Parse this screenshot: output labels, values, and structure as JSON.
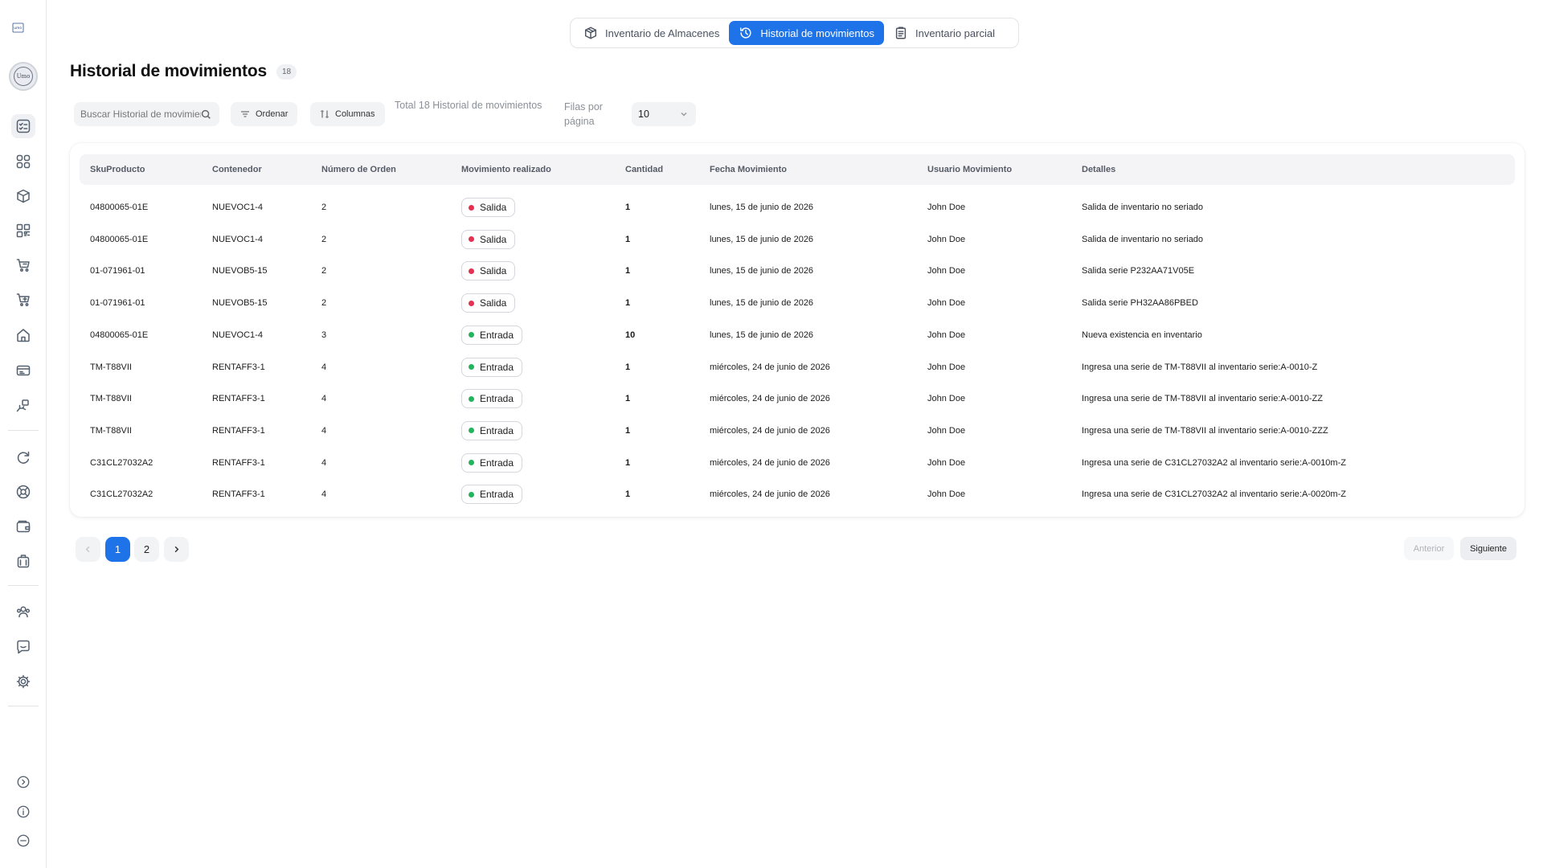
{
  "sidebar": {
    "logo_icon": "company-logo-icon",
    "avatar_text": "Umo",
    "items": [
      {
        "name": "sidebar-item-movements",
        "icon": "checklist-icon",
        "active": true
      },
      {
        "name": "sidebar-item-dashboard",
        "icon": "grid-icon"
      },
      {
        "name": "sidebar-item-products",
        "icon": "box-icon"
      },
      {
        "name": "sidebar-item-qr",
        "icon": "qr-code-icon"
      },
      {
        "name": "sidebar-item-purchases",
        "icon": "cart-icon"
      },
      {
        "name": "sidebar-item-orders",
        "icon": "cart-alt-icon"
      },
      {
        "name": "sidebar-item-warehouse",
        "icon": "home-icon"
      },
      {
        "name": "sidebar-item-tickets",
        "icon": "ticket-icon"
      },
      {
        "name": "sidebar-item-rentals",
        "icon": "hand-icon"
      },
      {
        "name": "sidebar-item-sync",
        "icon": "refresh-icon"
      },
      {
        "name": "sidebar-item-support",
        "icon": "lifebuoy-icon"
      },
      {
        "name": "sidebar-item-wallet",
        "icon": "wallet-icon"
      },
      {
        "name": "sidebar-item-documents",
        "icon": "briefcase-icon"
      },
      {
        "name": "sidebar-item-users",
        "icon": "users-icon"
      },
      {
        "name": "sidebar-item-messages",
        "icon": "chat-icon"
      },
      {
        "name": "sidebar-item-settings",
        "icon": "gear-icon"
      }
    ],
    "footer": [
      {
        "name": "expand-button",
        "icon": "chevron-right-circle-icon"
      },
      {
        "name": "info-button",
        "icon": "info-icon"
      },
      {
        "name": "logout-button",
        "icon": "minus-circle-icon"
      }
    ]
  },
  "tabs": [
    {
      "label": "Inventario de Almacenes",
      "icon": "package-icon",
      "active": false
    },
    {
      "label": "Historial de movimientos",
      "icon": "history-icon",
      "active": true
    },
    {
      "label": "Inventario parcial",
      "icon": "clipboard-icon",
      "active": false
    }
  ],
  "header": {
    "title": "Historial de movimientos",
    "count": "18"
  },
  "toolbar": {
    "search_placeholder": "Buscar Historial de movimientos",
    "sort_label": "Ordenar",
    "columns_label": "Columnas",
    "total_text": "Total 18 Historial de movimientos",
    "rows_label": "Filas por página",
    "rows_value": "10"
  },
  "colors": {
    "accent": "#1f73e8",
    "salida": "#e5304f",
    "entrada": "#22b45a"
  },
  "table": {
    "columns": [
      "SkuProducto",
      "Contenedor",
      "Número de Orden",
      "Movimiento realizado",
      "Cantidad",
      "Fecha Movimiento",
      "Usuario Movimiento",
      "Detalles"
    ],
    "rows": [
      [
        "04800065-01E",
        "NUEVOC1-4",
        "2",
        "Salida",
        "1",
        "lunes, 15 de junio de 2026",
        "John Doe",
        "Salida de inventario no seriado"
      ],
      [
        "04800065-01E",
        "NUEVOC1-4",
        "2",
        "Salida",
        "1",
        "lunes, 15 de junio de 2026",
        "John Doe",
        "Salida de inventario no seriado"
      ],
      [
        "01-071961-01",
        "NUEVOB5-15",
        "2",
        "Salida",
        "1",
        "lunes, 15 de junio de 2026",
        "John Doe",
        "Salida serie P232AA71V05E"
      ],
      [
        "01-071961-01",
        "NUEVOB5-15",
        "2",
        "Salida",
        "1",
        "lunes, 15 de junio de 2026",
        "John Doe",
        "Salida serie PH32AA86PBED"
      ],
      [
        "04800065-01E",
        "NUEVOC1-4",
        "3",
        "Entrada",
        "10",
        "lunes, 15 de junio de 2026",
        "John Doe",
        "Nueva existencia en inventario"
      ],
      [
        "TM-T88VII",
        "RENTAFF3-1",
        "4",
        "Entrada",
        "1",
        "miércoles, 24 de junio de 2026",
        "John Doe",
        "Ingresa una serie de TM-T88VII al inventario serie:A-0010-Z"
      ],
      [
        "TM-T88VII",
        "RENTAFF3-1",
        "4",
        "Entrada",
        "1",
        "miércoles, 24 de junio de 2026",
        "John Doe",
        "Ingresa una serie de TM-T88VII al inventario serie:A-0010-ZZ"
      ],
      [
        "TM-T88VII",
        "RENTAFF3-1",
        "4",
        "Entrada",
        "1",
        "miércoles, 24 de junio de 2026",
        "John Doe",
        "Ingresa una serie de TM-T88VII al inventario serie:A-0010-ZZZ"
      ],
      [
        "C31CL27032A2",
        "RENTAFF3-1",
        "4",
        "Entrada",
        "1",
        "miércoles, 24 de junio de 2026",
        "John Doe",
        "Ingresa una serie de C31CL27032A2 al inventario serie:A-0010m-Z"
      ],
      [
        "C31CL27032A2",
        "RENTAFF3-1",
        "4",
        "Entrada",
        "1",
        "miércoles, 24 de junio de 2026",
        "John Doe",
        "Ingresa una serie de C31CL27032A2 al inventario serie:A-0020m-Z"
      ]
    ]
  },
  "pagination": {
    "pages": [
      "1",
      "2"
    ],
    "current": "1",
    "prev_label": "Anterior",
    "next_label": "Siguiente"
  }
}
